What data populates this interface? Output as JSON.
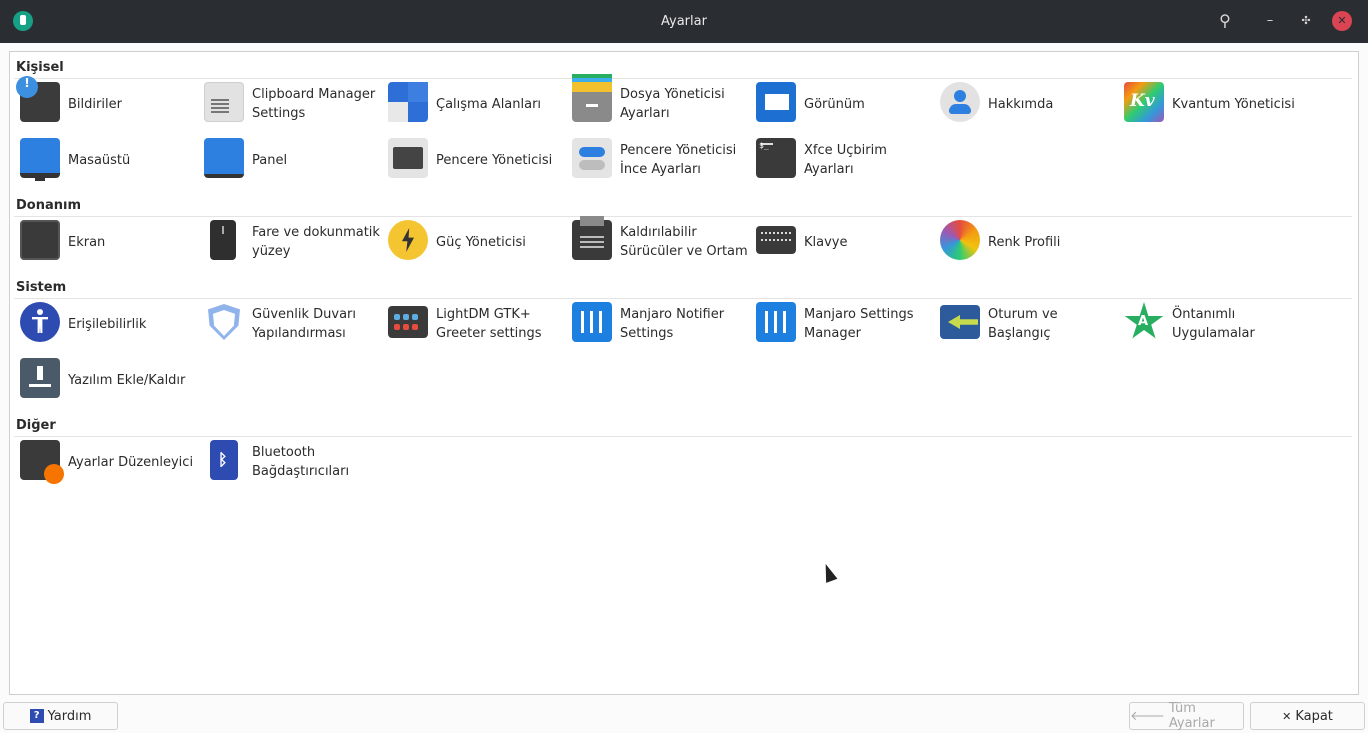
{
  "window": {
    "title": "Ayarlar"
  },
  "sections": {
    "kisisel": "Kişisel",
    "donanim": "Donanım",
    "sistem": "Sistem",
    "diger": "Diğer"
  },
  "items": {
    "bildiriler": "Bildiriler",
    "clipboard": "Clipboard Manager Settings",
    "calisma": "Çalışma Alanları",
    "dosya": "Dosya Yöneticisi Ayarları",
    "gorunum": "Görünüm",
    "hakkimda": "Hakkımda",
    "kvantum": "Kvantum Yöneticisi",
    "masaustu": "Masaüstü",
    "panel": "Panel",
    "pencere": "Pencere Yöneticisi",
    "ince": "Pencere Yöneticisi İnce Ayarları",
    "xfce": "Xfce Uçbirim Ayarları",
    "ekran": "Ekran",
    "fare": "Fare ve dokunmatik yüzey",
    "guc": "Güç Yöneticisi",
    "kaldirilabilir": "Kaldırılabilir Sürücüler ve Ortam",
    "klavye": "Klavye",
    "renk": "Renk Profili",
    "erisilebilirlik": "Erişilebilirlik",
    "guvenlik": "Güvenlik Duvarı Yapılandırması",
    "lightdm": "LightDM GTK+ Greeter settings",
    "notifier": "Manjaro Notifier Settings",
    "msm": "Manjaro Settings Manager",
    "oturum": "Oturum ve Başlangıç",
    "ontanimli": "Öntanımlı Uygulamalar",
    "yazilim": "Yazılım Ekle/Kaldır",
    "ayarlar_duz": "Ayarlar Düzenleyici",
    "bluetooth": "Bluetooth Bağdaştırıcıları"
  },
  "buttons": {
    "help": "Yardım",
    "all_settings": "Tüm Ayarlar",
    "close": "Kapat"
  },
  "glyphs": {
    "help_icon": "?",
    "search_icon": "⚲",
    "minimize_icon": "–",
    "restore_icon": "✣",
    "close_icon": "✕",
    "back_arrow_icon": "🡐",
    "close_x_icon": "✕",
    "kvantum_text": "Kv",
    "alert": "!",
    "terminal": "$_",
    "bluetooth": "ᛒ",
    "default_apps": "A",
    "gear": "⚙"
  },
  "colors": {
    "titlebar": "#2a2e32",
    "accent": "#2d7fe0",
    "close_button": "#da4453"
  }
}
